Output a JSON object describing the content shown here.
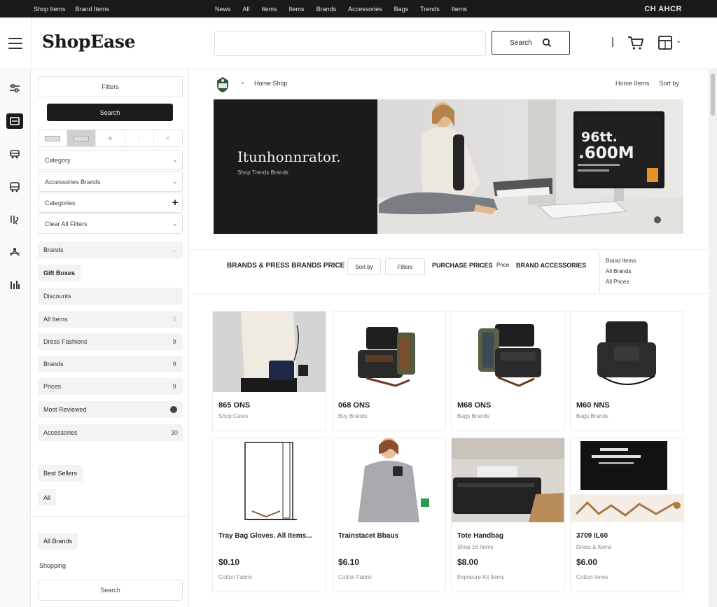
{
  "topbar": {
    "left_links": [
      "Shop Items",
      "Brand Items"
    ],
    "mid_links": [
      "News",
      "All",
      "Items",
      "Items",
      "Brands",
      "Accessories",
      "Bags",
      "Trends",
      "Items"
    ],
    "right_link": "CH AHCR"
  },
  "header": {
    "logo": "ShopEase",
    "search_placeholder": "",
    "search_button": "Search",
    "icons": [
      "menu-icon",
      "search-icon",
      "cart-icon",
      "account-icon"
    ]
  },
  "rail": {
    "items": [
      "filter-icon",
      "list-icon",
      "vehicle-icon",
      "bus-icon",
      "tag-icon",
      "network-icon",
      "chart-icon"
    ],
    "active_index": 1
  },
  "filters": {
    "top_button": "Filters",
    "search_button": "Search",
    "view_toggle": [
      "",
      "",
      "o",
      ":",
      "<"
    ],
    "dropdowns": [
      {
        "label": "Category",
        "control": "chev"
      },
      {
        "label": "Accessories Brands",
        "control": "chev"
      },
      {
        "label": "Categories",
        "control": "plus"
      },
      {
        "label": "Clear All Filters",
        "control": "chev"
      }
    ],
    "section_toggle": "Brands",
    "chip_1": "Gift Boxes",
    "facets": [
      {
        "label": "Discounts",
        "count": ""
      },
      {
        "label": "All Items",
        "count": "5"
      },
      {
        "label": "Dress Fashions",
        "count": "9"
      },
      {
        "label": "Brands",
        "count": "9"
      },
      {
        "label": "Prices",
        "count": "9"
      },
      {
        "label": "Most Reviewed",
        "count": "dot"
      },
      {
        "label": "Accessories",
        "count": "30"
      }
    ],
    "chip_2": "Best Sellers",
    "chip_3": "All",
    "chip_4": "All Brands",
    "plain_label": "Shopping",
    "bottom_button": "Search"
  },
  "main": {
    "breadcrumb_label": "Home Shop",
    "breadcrumb_right": [
      "Home Items",
      "Sort by"
    ],
    "banner": {
      "title": "Itunhonnrator.",
      "subtitle": "Shop Trends Brands",
      "screen_text_1": "96tt.",
      "screen_text_2": ".600M"
    },
    "feature": {
      "headline": "BRANDS & PRESS BRANDS PRICE",
      "btn_1": "Sort by",
      "btn_2": "Filters",
      "text_1": "PURCHASE PRICES",
      "text_2": "Price",
      "text_3": "BRAND ACCESSORIES",
      "list": [
        "Brand Items",
        "All Brands",
        "All Prices"
      ]
    },
    "products": [
      {
        "name": "865 ONS",
        "sub": "Shop Cares",
        "price": ""
      },
      {
        "name": "068 ONS",
        "sub": "Buy Brands",
        "price": ""
      },
      {
        "name": "M68 ONS",
        "sub": "Bags Brands",
        "price": ""
      },
      {
        "name": "M60 NNS",
        "sub": "Bags Brands",
        "price": ""
      },
      {
        "name": "Tray Bag Gloves. All Items...",
        "sub": "",
        "price": "$0.10",
        "sub2": "Cotton Fabric"
      },
      {
        "name": "Trainstacet Bbaus",
        "sub": "",
        "price": "$6.10",
        "sub2": "Cotton Fabric"
      },
      {
        "name": "Tote Handbag",
        "sub": "Shop 16 Items",
        "price": "$8.00",
        "sub2": "Exposure Kit Items"
      },
      {
        "name": "3709 IL60",
        "sub": "Dress & Items",
        "price": "$6.00",
        "sub2": "Cotton Items"
      }
    ]
  },
  "colors": {
    "topbar_bg": "#1a1a1a",
    "accent_dark": "#1c1c1c",
    "panel_grey": "#f3f3f3"
  }
}
